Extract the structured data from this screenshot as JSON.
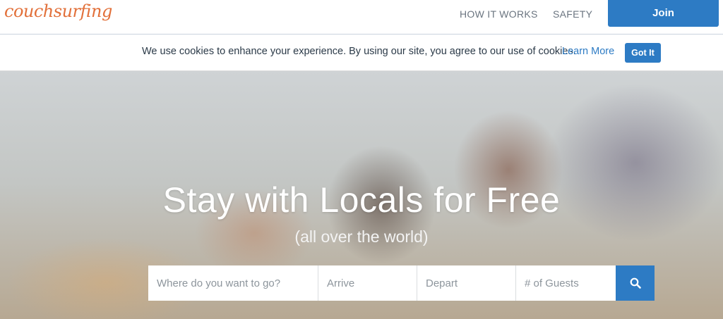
{
  "header": {
    "logo": "couchsurfing",
    "nav": [
      "HOW IT WORKS",
      "SAFETY"
    ],
    "join_label": "Join"
  },
  "cookie_bar": {
    "message": "We use cookies to enhance your experience. By using our site, you agree to our use of cookies.",
    "learn_more": "Learn More",
    "got_it": "Got It"
  },
  "hero": {
    "title": "Stay with Locals for Free",
    "subtitle": "(all over the world)"
  },
  "search": {
    "destination_placeholder": "Where do you want to go?",
    "arrive_placeholder": "Arrive",
    "depart_placeholder": "Depart",
    "guests_placeholder": "# of Guests",
    "button_icon": "search-icon"
  },
  "colors": {
    "brand_orange": "#e2703a",
    "accent_blue": "#2d7bc4"
  }
}
